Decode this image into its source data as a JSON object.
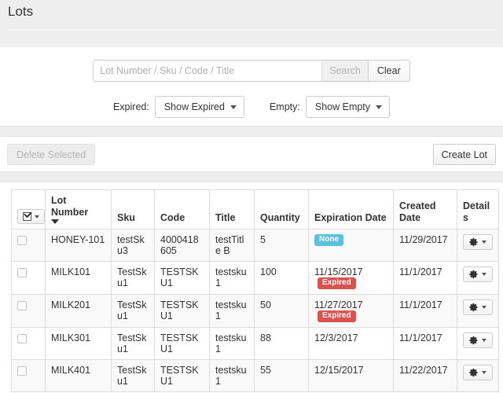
{
  "page": {
    "title": "Lots"
  },
  "search": {
    "placeholder": "Lot Number / Sku / Code / Title",
    "value": "",
    "search_label": "Search",
    "clear_label": "Clear"
  },
  "filters": [
    {
      "label": "Expired:",
      "value": "Show Expired"
    },
    {
      "label": "Empty:",
      "value": "Show Empty"
    }
  ],
  "actions": {
    "delete_label": "Delete Selected",
    "create_label": "Create Lot"
  },
  "table": {
    "headers": {
      "select": "",
      "lot_number": "Lot Number",
      "sku": "Sku",
      "code": "Code",
      "title": "Title",
      "quantity": "Quantity",
      "expiration_date": "Expiration Date",
      "created_date": "Created Date",
      "details": "Details"
    },
    "sort": {
      "column": "Lot Number",
      "direction": "desc"
    },
    "rows": [
      {
        "lot_number": "HONEY-101",
        "sku": "testSku3",
        "code": "4000418605",
        "title": "testTitle B",
        "quantity": "5",
        "expiration_date": "",
        "expiration_badge": "None",
        "created_date": "11/29/2017"
      },
      {
        "lot_number": "MILK101",
        "sku": "TestSku1",
        "code": "TESTSKU1",
        "title": "testsku1",
        "quantity": "100",
        "expiration_date": "11/15/2017",
        "expiration_badge": "Expired",
        "created_date": "11/1/2017"
      },
      {
        "lot_number": "MILK201",
        "sku": "TestSku1",
        "code": "TESTSKU1",
        "title": "testsku1",
        "quantity": "50",
        "expiration_date": "11/27/2017",
        "expiration_badge": "Expired",
        "created_date": "11/1/2017"
      },
      {
        "lot_number": "MILK301",
        "sku": "TestSku1",
        "code": "TESTSKU1",
        "title": "testsku1",
        "quantity": "88",
        "expiration_date": "12/3/2017",
        "expiration_badge": "",
        "created_date": "11/1/2017"
      },
      {
        "lot_number": "MILK401",
        "sku": "TestSku1",
        "code": "TESTSKU1",
        "title": "testsku1",
        "quantity": "55",
        "expiration_date": "12/15/2017",
        "expiration_badge": "",
        "created_date": "11/22/2017"
      }
    ]
  },
  "colors": {
    "badge_none": "#5bc0de",
    "badge_expired": "#d9534f",
    "header_band": "#eeeeee",
    "table_border": "#dddddd",
    "row_stripe": "#f9f9f9"
  }
}
